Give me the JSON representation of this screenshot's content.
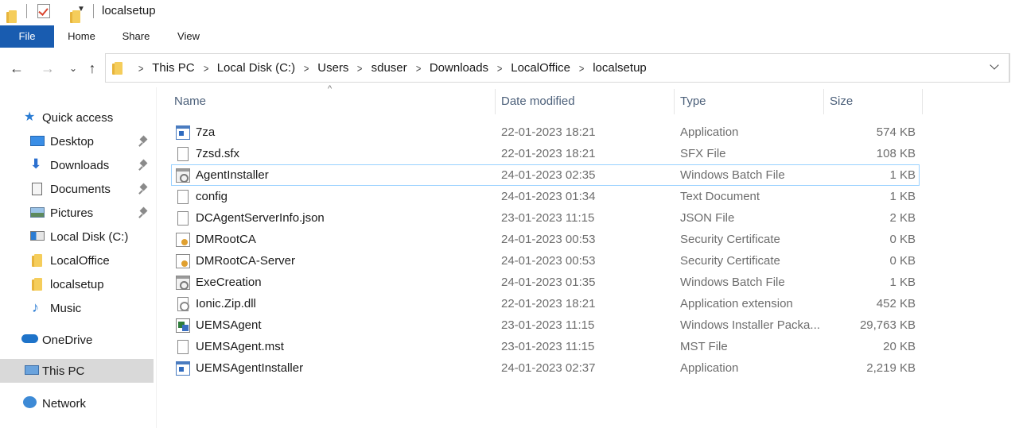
{
  "window": {
    "title": "localsetup"
  },
  "ribbon": {
    "tabs": [
      "File",
      "Home",
      "Share",
      "View"
    ]
  },
  "address": {
    "crumbs": [
      "This PC",
      "Local Disk (C:)",
      "Users",
      "sduser",
      "Downloads",
      "LocalOffice",
      "localsetup"
    ]
  },
  "nav": {
    "quick_access": "Quick access",
    "items": [
      "Desktop",
      "Downloads",
      "Documents",
      "Pictures",
      "Local Disk (C:)",
      "LocalOffice",
      "localsetup",
      "Music"
    ],
    "onedrive": "OneDrive",
    "this_pc": "This PC",
    "network": "Network"
  },
  "columns": {
    "name": "Name",
    "date": "Date modified",
    "type": "Type",
    "size": "Size"
  },
  "files": [
    {
      "name": "7za",
      "date": "22-01-2023 18:21",
      "type": "Application",
      "size": "574 KB",
      "icon": "application-icon"
    },
    {
      "name": "7zsd.sfx",
      "date": "22-01-2023 18:21",
      "type": "SFX File",
      "size": "108 KB",
      "icon": "file-icon"
    },
    {
      "name": "AgentInstaller",
      "date": "24-01-2023 02:35",
      "type": "Windows Batch File",
      "size": "1 KB",
      "icon": "batch-file-icon"
    },
    {
      "name": "config",
      "date": "24-01-2023 01:34",
      "type": "Text Document",
      "size": "1 KB",
      "icon": "text-file-icon"
    },
    {
      "name": "DCAgentServerInfo.json",
      "date": "23-01-2023 11:15",
      "type": "JSON File",
      "size": "2 KB",
      "icon": "file-icon"
    },
    {
      "name": "DMRootCA",
      "date": "24-01-2023 00:53",
      "type": "Security Certificate",
      "size": "0 KB",
      "icon": "certificate-icon"
    },
    {
      "name": "DMRootCA-Server",
      "date": "24-01-2023 00:53",
      "type": "Security Certificate",
      "size": "0 KB",
      "icon": "certificate-icon"
    },
    {
      "name": "ExeCreation",
      "date": "24-01-2023 01:35",
      "type": "Windows Batch File",
      "size": "1 KB",
      "icon": "batch-file-icon"
    },
    {
      "name": "Ionic.Zip.dll",
      "date": "22-01-2023 18:21",
      "type": "Application extension",
      "size": "452 KB",
      "icon": "dll-file-icon"
    },
    {
      "name": "UEMSAgent",
      "date": "23-01-2023 11:15",
      "type": "Windows Installer Packa...",
      "size": "29,763 KB",
      "icon": "installer-icon"
    },
    {
      "name": "UEMSAgent.mst",
      "date": "23-01-2023 11:15",
      "type": "MST File",
      "size": "20 KB",
      "icon": "file-icon"
    },
    {
      "name": "UEMSAgentInstaller",
      "date": "24-01-2023 02:37",
      "type": "Application",
      "size": "2,219 KB",
      "icon": "application-icon"
    }
  ]
}
